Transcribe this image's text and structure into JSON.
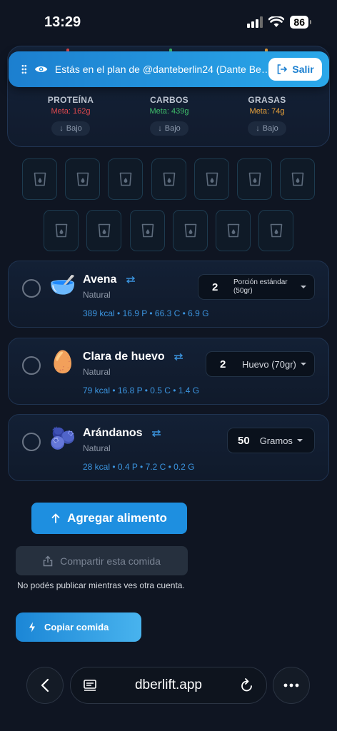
{
  "status": {
    "time": "13:29",
    "battery": "86"
  },
  "banner": {
    "text": "Estás en el plan de @danteberlin24 (Dante Be…",
    "exit_label": "Salir"
  },
  "macros": [
    {
      "name": "PROTEÍNA",
      "goal": "Meta: 162g",
      "goal_color": "#e0494e",
      "status": "Bajo"
    },
    {
      "name": "CARBOS",
      "goal": "Meta: 439g",
      "goal_color": "#3fbf6a",
      "status": "Bajo"
    },
    {
      "name": "GRASAS",
      "goal": "Meta: 74g",
      "goal_color": "#e9a23b",
      "status": "Bajo"
    }
  ],
  "water": {
    "glasses_total": 13,
    "glasses_filled": 0
  },
  "foods": [
    {
      "emoji": "🥣",
      "name": "Avena",
      "type": "Natural",
      "quantity": "2",
      "unit": "Porción estándar (50gr)",
      "macros": "389 kcal • 16.9 P • 66.3 C • 6.9 G"
    },
    {
      "emoji": "🥚",
      "name": "Clara de huevo",
      "type": "Natural",
      "quantity": "2",
      "unit": "Huevo (70gr)",
      "macros": "79 kcal • 16.8 P • 0.5 C • 1.4 G"
    },
    {
      "emoji": "🫐",
      "name": "Arándanos",
      "type": "Natural",
      "quantity": "50",
      "unit": "Gramos",
      "macros": "28 kcal • 0.4 P • 7.2 C • 0.2 G"
    }
  ],
  "actions": {
    "add_food": "Agregar alimento",
    "share_meal": "Compartir esta comida",
    "share_note": "No podés publicar mientras ves otra cuenta.",
    "copy_meal": "Copiar comida"
  },
  "browser": {
    "url": "dberlift.app"
  },
  "colors": {
    "accent": "#1e8fe0",
    "background": "#0f1522"
  }
}
